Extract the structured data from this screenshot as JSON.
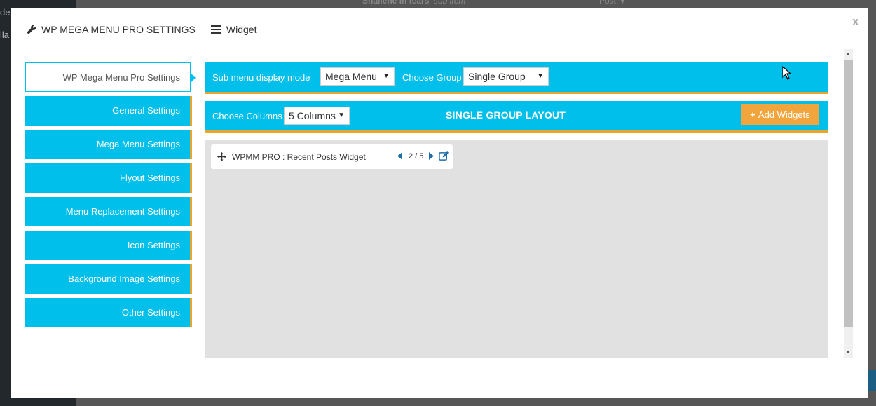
{
  "background": {
    "left_text_1": "de",
    "left_text_2": "lla",
    "top_item_name": "Shailene In tears",
    "top_item_type": "sub item",
    "top_item_post": "Post"
  },
  "modal": {
    "close_label": "x",
    "title": "WP MEGA MENU PRO SETTINGS",
    "widget_tab_label": "Widget"
  },
  "sidebar": {
    "items": [
      {
        "label": "WP Mega Menu Pro Settings"
      },
      {
        "label": "General Settings"
      },
      {
        "label": "Mega Menu Settings"
      },
      {
        "label": "Flyout Settings"
      },
      {
        "label": "Menu Replacement Settings"
      },
      {
        "label": "Icon Settings"
      },
      {
        "label": "Background Image Settings"
      },
      {
        "label": "Other Settings"
      }
    ]
  },
  "display_bar": {
    "display_mode_label": "Sub menu display mode",
    "display_mode_value": "Mega Menu",
    "group_label": "Choose Group",
    "group_value": "Single Group"
  },
  "layout_bar": {
    "columns_label": "Choose Columns",
    "columns_value": "5 Columns",
    "layout_title": "SINGLE GROUP LAYOUT",
    "add_widgets_label": "Add Widgets"
  },
  "widgets": [
    {
      "name": "WPMM PRO : Recent Posts Widget",
      "columns": "2 / 5"
    }
  ],
  "colors": {
    "accent": "#00bfea",
    "border_accent": "#e8a62f",
    "add_button": "#f2a53c",
    "canvas": "#e1e1e1"
  }
}
